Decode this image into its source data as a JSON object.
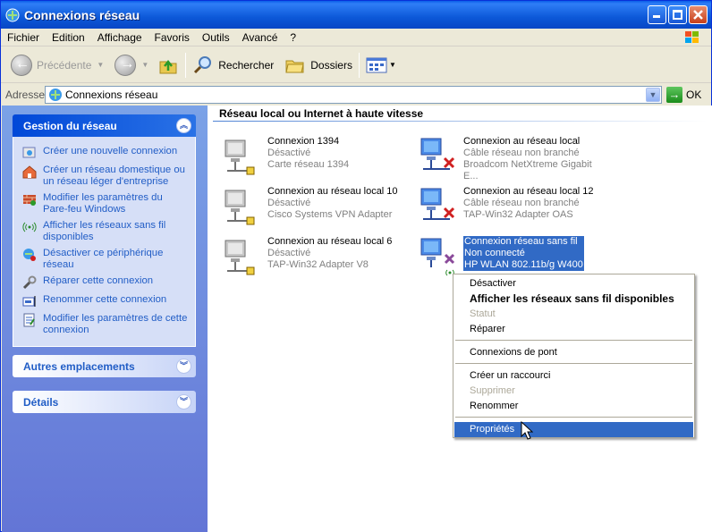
{
  "window": {
    "title": "Connexions réseau"
  },
  "menu": [
    "Fichier",
    "Edition",
    "Affichage",
    "Favoris",
    "Outils",
    "Avancé",
    "?"
  ],
  "toolbar": {
    "back": "Précédente",
    "search": "Rechercher",
    "folders": "Dossiers"
  },
  "address": {
    "label": "Adresse",
    "value": "Connexions réseau",
    "go": "OK"
  },
  "sidebar": {
    "network_tasks": {
      "title": "Gestion du réseau",
      "items": [
        "Créer une nouvelle connexion",
        "Créer un réseau domestique ou un réseau léger d'entreprise",
        "Modifier les paramètres du Pare-feu Windows",
        "Afficher les réseaux sans fil disponibles",
        "Désactiver ce périphérique réseau",
        "Réparer cette connexion",
        "Renommer cette connexion",
        "Modifier les paramètres de cette connexion"
      ]
    },
    "other_places": {
      "title": "Autres emplacements"
    },
    "details": {
      "title": "Détails"
    }
  },
  "content": {
    "group_title": "Réseau local ou Internet à haute vitesse",
    "connections": [
      {
        "name": "Connexion 1394",
        "status": "Désactivé",
        "device": "Carte réseau 1394"
      },
      {
        "name": "Connexion au réseau local",
        "status": "Câble réseau non branché",
        "device": "Broadcom NetXtreme Gigabit E..."
      },
      {
        "name": "Connexion au réseau local 10",
        "status": "Désactivé",
        "device": "Cisco Systems VPN Adapter"
      },
      {
        "name": "Connexion au réseau local 12",
        "status": "Câble réseau non branché",
        "device": "TAP-Win32 Adapter OAS"
      },
      {
        "name": "Connexion au réseau local 6",
        "status": "Désactivé",
        "device": "TAP-Win32 Adapter V8"
      },
      {
        "name": "Connexion réseau sans fil",
        "status": "Non connecté",
        "device": "HP WLAN 802.11b/g W400"
      }
    ]
  },
  "context_menu": {
    "items": [
      "Désactiver",
      "Afficher les réseaux sans fil disponibles",
      "Statut",
      "Réparer",
      "Connexions de pont",
      "Créer un raccourci",
      "Supprimer",
      "Renommer",
      "Propriétés"
    ]
  },
  "colors": {
    "selection": "#316ac5",
    "link": "#215dc6",
    "titlebar": "#0c58d8"
  }
}
